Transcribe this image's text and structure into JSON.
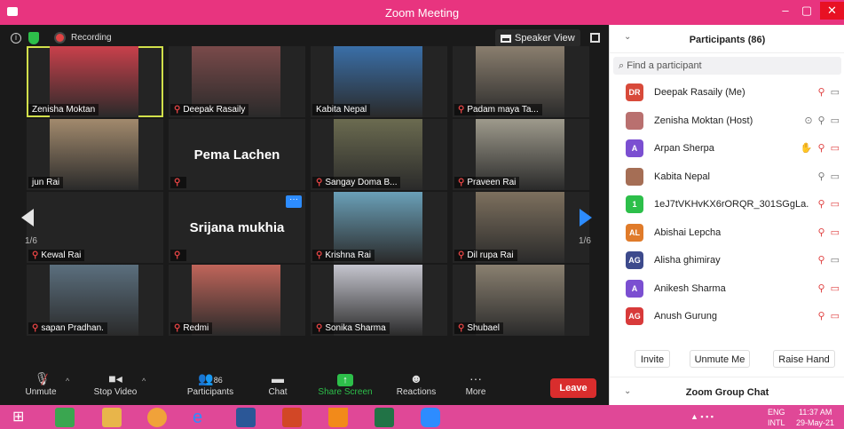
{
  "window": {
    "title": "Zoom Meeting"
  },
  "topbar": {
    "recording_label": "Recording",
    "view_label": "Speaker View"
  },
  "tiles": [
    {
      "name": "Zenisha Moktan",
      "muted": false,
      "color": "#c9404b"
    },
    {
      "name": "Deepak Rasaily",
      "muted": true,
      "color": "#7a4a4a"
    },
    {
      "name": "Kabita Nepal",
      "muted": false,
      "color": "#3a6fa8"
    },
    {
      "name": "Padam maya Ta...",
      "muted": true,
      "color": "#8a7e6e"
    },
    {
      "name": "jun Rai",
      "muted": false,
      "color": "#a28a6d"
    },
    {
      "name": "",
      "muted": true,
      "big_name": "Pema Lachen"
    },
    {
      "name": "Sangay Doma B...",
      "muted": true,
      "color": "#6b6b50"
    },
    {
      "name": "Praveen Rai",
      "muted": true,
      "color": "#9e9a8c"
    },
    {
      "name": "Kewal Rai",
      "muted": true
    },
    {
      "name": "",
      "muted": true,
      "big_name": "Srijana  mukhia"
    },
    {
      "name": "Krishna Rai",
      "muted": true,
      "color": "#6aa0b8"
    },
    {
      "name": "Dil rupa Rai",
      "muted": true,
      "color": "#7d705e"
    },
    {
      "name": "sapan Pradhan.",
      "muted": true,
      "color": "#5b6f7e"
    },
    {
      "name": "Redmi",
      "muted": true,
      "color": "#c0655a"
    },
    {
      "name": "Sonika Sharma",
      "muted": true,
      "color": "#c5c5ce"
    },
    {
      "name": "Shubael",
      "muted": true,
      "color": "#8a8070"
    }
  ],
  "pagination": {
    "left": "1/6",
    "right": "1/6"
  },
  "toolbar": {
    "unmute": "Unmute",
    "stop_video": "Stop Video",
    "participants": "Participants",
    "participants_count": "86",
    "chat": "Chat",
    "share_screen": "Share Screen",
    "reactions": "Reactions",
    "more": "More",
    "leave": "Leave"
  },
  "panel": {
    "title": "Participants (86)",
    "search_placeholder": "Find a participant",
    "participants": [
      {
        "initials": "DR",
        "name": "Deepak Rasaily (Me)",
        "color": "#d84a3a",
        "icons": [
          "mic-muted",
          "cam-off"
        ]
      },
      {
        "initials": "",
        "name": "Zenisha Moktan (Host)",
        "color": "#b9706f",
        "icons": [
          "rec",
          "mic",
          "cam"
        ]
      },
      {
        "initials": "A",
        "name": "Arpan Sherpa",
        "color": "#7b4fd1",
        "icons": [
          "hand",
          "mic-muted",
          "cam-muted"
        ]
      },
      {
        "initials": "",
        "name": "Kabita Nepal",
        "color": "#a56e55",
        "icons": [
          "mic",
          "cam"
        ]
      },
      {
        "initials": "1",
        "name": "1eJ7tVKHvKX6rORQR_301SGgLa...",
        "color": "#2dbf4a",
        "icons": [
          "mic-muted",
          "cam-muted"
        ]
      },
      {
        "initials": "AL",
        "name": "Abishai Lepcha",
        "color": "#e07b2a",
        "icons": [
          "mic-muted",
          "cam-muted"
        ]
      },
      {
        "initials": "AG",
        "name": "Alisha ghimiray",
        "color": "#3d4a8c",
        "icons": [
          "mic-muted",
          "cam"
        ]
      },
      {
        "initials": "A",
        "name": "Anikesh Sharma",
        "color": "#7b4fd1",
        "icons": [
          "mic-muted",
          "cam-muted"
        ]
      },
      {
        "initials": "AG",
        "name": "Anush Gurung",
        "color": "#d83a3a",
        "icons": [
          "mic-muted",
          "cam-muted"
        ]
      }
    ],
    "actions": {
      "invite": "Invite",
      "unmute_me": "Unmute Me",
      "raise_hand": "Raise Hand"
    },
    "chat_title": "Zoom Group Chat"
  },
  "taskbar": {
    "lang": "ENG",
    "lang2": "INTL",
    "time": "11:37 AM",
    "date": "29-May-21"
  }
}
